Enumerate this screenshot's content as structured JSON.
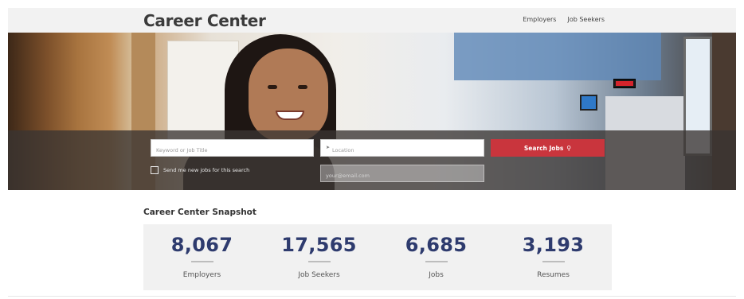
{
  "header": {
    "logo": "Career Center",
    "nav": [
      {
        "label": "Employers"
      },
      {
        "label": "Job Seekers"
      }
    ]
  },
  "search": {
    "keyword_placeholder": "Keyword or Job Title",
    "keyword_value": "",
    "location_placeholder": "Location",
    "location_value": "",
    "search_button_label": "Search Jobs",
    "search_icon": "magnifier-icon",
    "alert_checkbox_label": "Send me new jobs for this search",
    "alert_checked": false,
    "email_placeholder": "your@email.com",
    "email_value": ""
  },
  "snapshot": {
    "title": "Career Center Snapshot",
    "stats": [
      {
        "value": "8,067",
        "label": "Employers"
      },
      {
        "value": "17,565",
        "label": "Job Seekers"
      },
      {
        "value": "6,685",
        "label": "Jobs"
      },
      {
        "value": "3,193",
        "label": "Resumes"
      }
    ]
  },
  "colors": {
    "accent_red": "#c9353d",
    "stat_number": "#2e3b6e",
    "header_bg": "#f2f2f2",
    "snapshot_bg": "#f1f1f1"
  }
}
